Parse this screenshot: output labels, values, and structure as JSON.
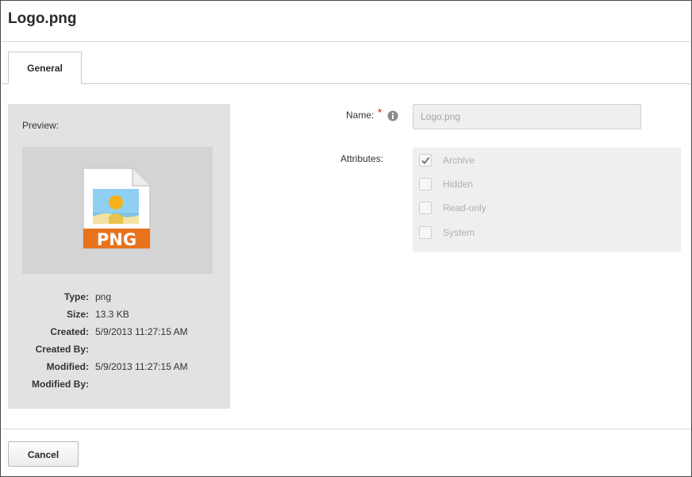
{
  "dialog": {
    "title": "Logo.png"
  },
  "tabs": [
    {
      "label": "General"
    }
  ],
  "preview": {
    "label": "Preview:",
    "file_icon": "png-file-icon",
    "icon_badge_text": "PNG",
    "meta": [
      {
        "key": "Type:",
        "value": "png"
      },
      {
        "key": "Size:",
        "value": "13.3 KB"
      },
      {
        "key": "Created:",
        "value": "5/9/2013 11:27:15 AM"
      },
      {
        "key": "Created By:",
        "value": ""
      },
      {
        "key": "Modified:",
        "value": "5/9/2013 11:27:15 AM"
      },
      {
        "key": "Modified By:",
        "value": ""
      }
    ]
  },
  "form": {
    "name_label": "Name:",
    "required_mark": "*",
    "name_value": "Logo.png",
    "attributes_label": "Attributes:",
    "attributes": [
      {
        "label": "Archive",
        "checked": true
      },
      {
        "label": "Hidden",
        "checked": false
      },
      {
        "label": "Read-only",
        "checked": false
      },
      {
        "label": "System",
        "checked": false
      }
    ]
  },
  "footer": {
    "cancel_label": "Cancel"
  },
  "colors": {
    "badge_orange": "#e8731c",
    "required_red": "#dd0000",
    "panel_gray": "#e2e2e2"
  }
}
